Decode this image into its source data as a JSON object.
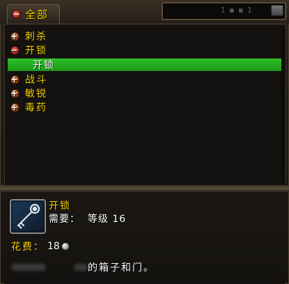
{
  "header": {
    "tab_all_label": "全部",
    "search_text": "1 ▪ ▪ 1"
  },
  "tree": [
    {
      "label": "刺杀",
      "expanded": false
    },
    {
      "label": "开锁",
      "expanded": true
    },
    {
      "label": "开锁",
      "selected": true
    },
    {
      "label": "战斗",
      "expanded": false
    },
    {
      "label": "敏锐",
      "expanded": false
    },
    {
      "label": "毒药",
      "expanded": false
    }
  ],
  "detail": {
    "name": "开锁",
    "requirement": "需要：  等级 16",
    "cost_label": "花费：",
    "cost_value": "18",
    "desc_visible": "的箱子和门。",
    "icon": "key-icon"
  },
  "colors": {
    "gold_text": "#f5d200",
    "selected_bg": "#1fa81b",
    "minus": "#c02a20",
    "plus": "#c06a28"
  }
}
